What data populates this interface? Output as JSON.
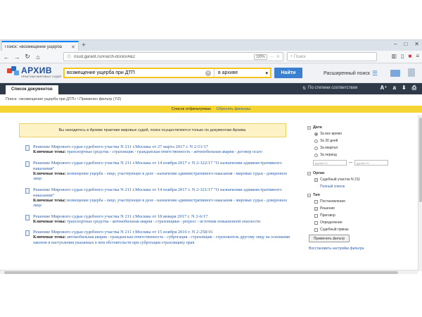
{
  "browser": {
    "tab_title": "Поиск: «возмещение ущерба",
    "url": "nsud.garant.ru/#/arch-docks/4&2",
    "zoom": "120%",
    "search_placeholder": "Поиск"
  },
  "header": {
    "logo_title": "АРХИВ",
    "logo_subtitle": "ПРАКТИКИ МИРОВЫХ СУДЕЙ",
    "search_query": "возмещение ущерба при ДТП",
    "scope": "в архиве",
    "find_label": "Найти",
    "advanced_label": "Расширенный поиск"
  },
  "toolbar": {
    "doclist_tab": "Список документов",
    "sort_label": "По степени соответствия",
    "font_size_icon": "A⁺",
    "font_size_small_icon": "a"
  },
  "breadcrumb": "Поиск: «возмещение ущерба при ДТП» \\ Применен фильтр (7/2)",
  "filterbar": {
    "text": "Список отфильтрован",
    "reset": "Сбросить фильтры"
  },
  "notice": "Вы находитесь в Архиве практики мировых судей, поиск осуществляется только по документам Архива.",
  "results": [
    {
      "title": "Решение Мирового судьи судебного участка N 211 г.Москвы от 27 марта 2017 г. N 2-51/17",
      "kw": "Ключевые темы:",
      "topics": " транспортные средства - страховщик - гражданская ответственность - автомобильная авария - договор осаго"
    },
    {
      "title": "Решение Мирового судьи судебного участка N 211 г.Москвы от 14 ноября 2017 г. N 2-322/17 \"О назначении административного наказания\"",
      "kw": "Ключевые темы:",
      "topics": " возмещение ущерба - лицо, участвующее в деле - назначение административного наказания - мировые судьи - доверенное лицо"
    },
    {
      "title": "Решение Мирового судьи судебного участка N 211 г.Москвы от 14 ноября 2017 г. N 2-321/17 \"О назначении административного наказания\"",
      "kw": "Ключевые темы:",
      "topics": " возмещение ущерба - лицо, участвующее в деле - назначение административного наказания - мировые судьи - доверенное лицо"
    },
    {
      "title": "Решение Мирового судьи судебного участка N 211 г.Москвы от 18 января 2017 г. N 2-6/17",
      "kw": "Ключевые темы:",
      "topics": " транспортные средства - автомобильная авария - страховщики - регресс - источник повышенной опасности"
    },
    {
      "title": "Решение Мирового судьи судебного участка N 211 г.Москвы от 15 ноября 2016 г. N 2-258/16",
      "kw": "Ключевые темы:",
      "topics": " автомобильная авария - гражданская ответственность - суброгация - страховщик - страхователь другому лицу на основании законов и наступления указанных в нем обстоятельств при суброгации страховщику прав"
    }
  ],
  "sidebar": {
    "date": {
      "title": "Дата",
      "options": [
        "За все время",
        "За 30 дней",
        "За квартал",
        "За период"
      ],
      "from_placeholder": "дд.мм.гггг",
      "to_placeholder": "дд.мм.гггг"
    },
    "organ": {
      "title": "Орган",
      "option": "Судебный участок N 211",
      "full_list": "Полный список"
    },
    "type": {
      "title": "Тип",
      "options": [
        "Постановление",
        "Решение",
        "Приговор",
        "Определение",
        "Судебный приказ"
      ]
    },
    "apply": "Применить фильтр",
    "restore": "Восстановить настройки фильтра"
  }
}
